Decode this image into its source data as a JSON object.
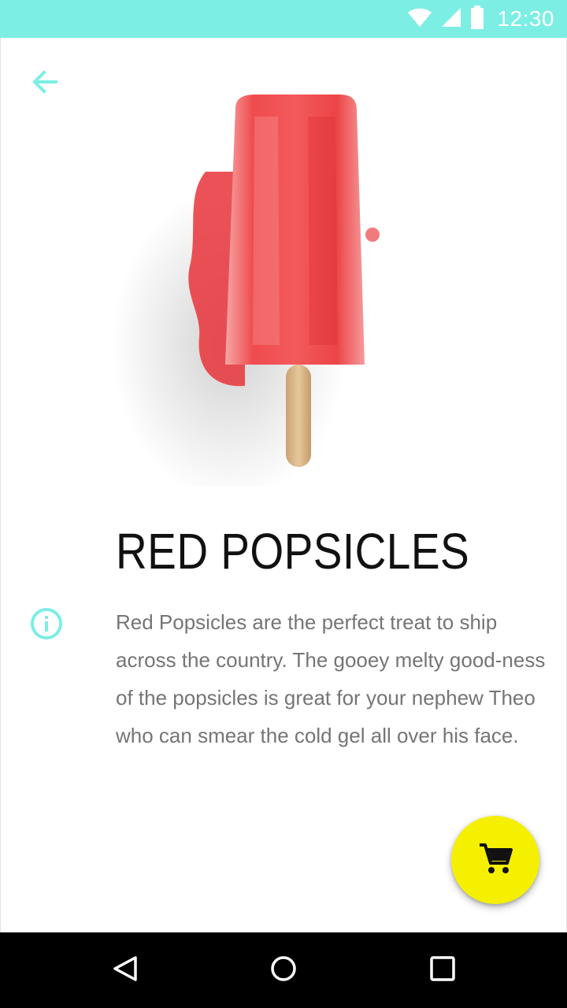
{
  "status_bar": {
    "time": "12:30",
    "icons": [
      "wifi-icon",
      "cellular-icon",
      "battery-icon"
    ],
    "background": "#7ceee4"
  },
  "toolbar": {
    "back_icon": "arrow-back-icon",
    "accent": "#7ceee4"
  },
  "product": {
    "image": "red-popsicle-image",
    "title": "RED POPSICLES",
    "info_icon": "info-icon",
    "description": "Red Popsicles are the perfect treat to ship across the country. The gooey melty good-ness of the popsicles is great for your nephew Theo who can smear the cold gel all over his face."
  },
  "fab": {
    "icon": "shopping-cart-icon",
    "color": "#f4f000"
  },
  "nav_bar": {
    "buttons": [
      "back-triangle-icon",
      "home-circle-icon",
      "recents-square-icon"
    ]
  }
}
